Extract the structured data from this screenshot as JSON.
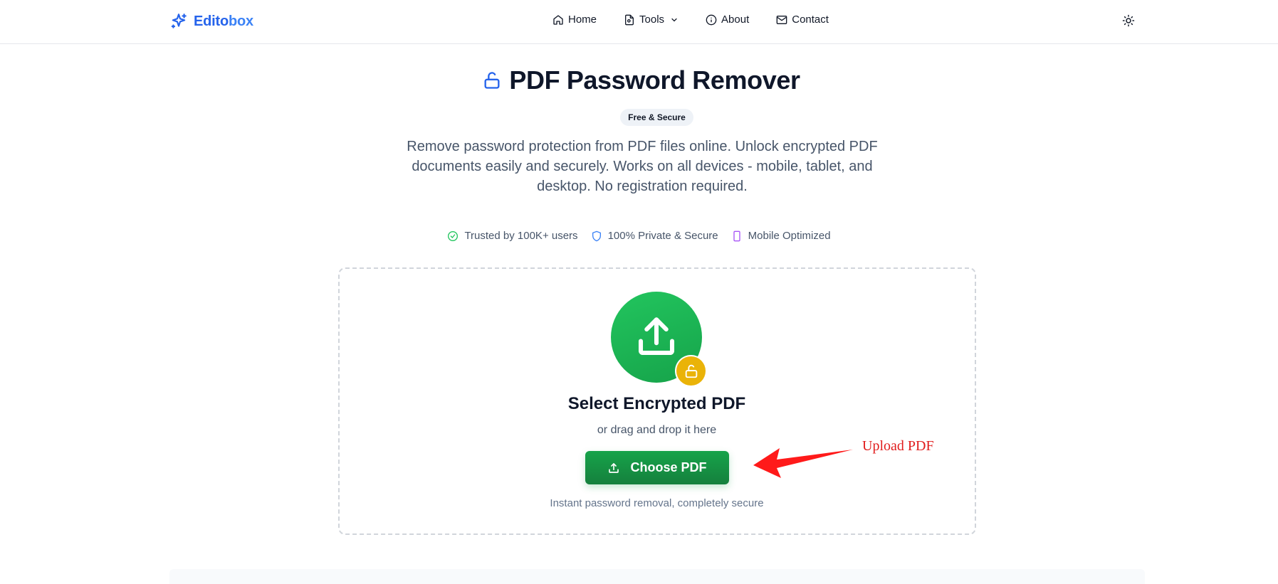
{
  "brand": {
    "name_part1": "Edito",
    "name_part2": "box",
    "color": "#2563eb"
  },
  "nav": {
    "home": "Home",
    "tools": "Tools",
    "about": "About",
    "contact": "Contact"
  },
  "theme_toggle_icon": "sun-icon",
  "hero": {
    "title": "PDF Password Remover",
    "badge": "Free & Secure",
    "description": "Remove password protection from PDF files online. Unlock encrypted PDF documents easily and securely. Works on all devices - mobile, tablet, and desktop. No registration required."
  },
  "trust": [
    {
      "label": "Trusted by 100K+ users",
      "icon": "check-circle-icon",
      "color": "#22c55e"
    },
    {
      "label": "100% Private & Secure",
      "icon": "shield-icon",
      "color": "#3b82f6"
    },
    {
      "label": "Mobile Optimized",
      "icon": "smartphone-icon",
      "color": "#a855f7"
    }
  ],
  "upload": {
    "title": "Select Encrypted PDF",
    "subtitle": "or drag and drop it here",
    "button": "Choose PDF",
    "hint": "Instant password removal, completely secure",
    "accent": "#16a34a",
    "lock_color": "#eab308"
  },
  "annotation": {
    "text": "Upload PDF",
    "color": "#e11d1d"
  }
}
